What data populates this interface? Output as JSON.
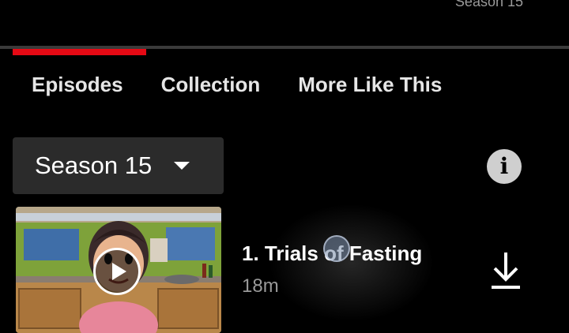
{
  "header": {
    "season_cut": "Season 15"
  },
  "tabs": [
    {
      "label": "Episodes",
      "active": true
    },
    {
      "label": "Collection",
      "active": false
    },
    {
      "label": "More Like This",
      "active": false
    }
  ],
  "season_selector": {
    "label": "Season 15"
  },
  "episodes": [
    {
      "title": "1. Trials of Fasting",
      "duration": "18m"
    }
  ],
  "colors": {
    "accent": "#e50914",
    "background": "#000000",
    "selector_bg": "#2b2b2b"
  },
  "icons": [
    "info-icon",
    "play-icon",
    "download-icon",
    "chevron-down-icon"
  ]
}
